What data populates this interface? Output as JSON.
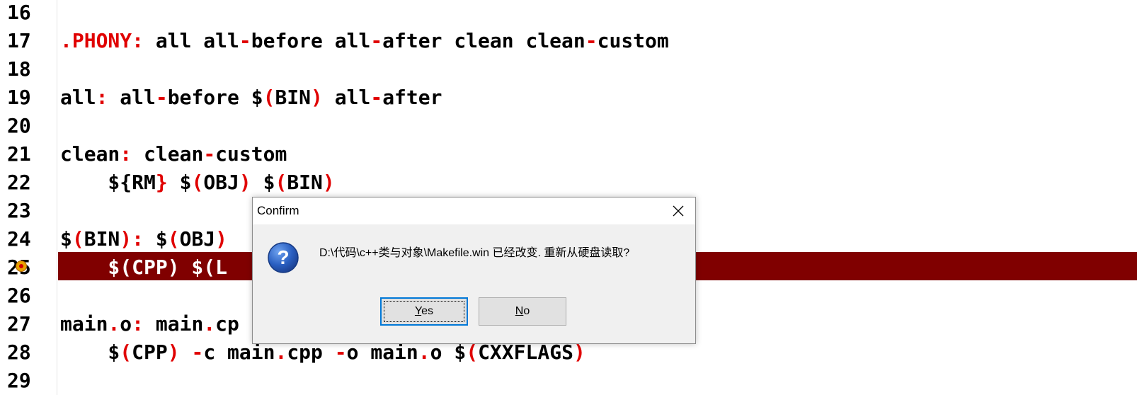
{
  "editor": {
    "lines": [
      {
        "num": "16",
        "segments": []
      },
      {
        "num": "17",
        "segments": [
          {
            "t": ".PHONY",
            "c": "red"
          },
          {
            "t": ":",
            "c": "red"
          },
          {
            "t": " all all",
            "c": ""
          },
          {
            "t": "-",
            "c": "red"
          },
          {
            "t": "before all",
            "c": ""
          },
          {
            "t": "-",
            "c": "red"
          },
          {
            "t": "after clean clean",
            "c": ""
          },
          {
            "t": "-",
            "c": "red"
          },
          {
            "t": "custom",
            "c": ""
          }
        ]
      },
      {
        "num": "18",
        "segments": []
      },
      {
        "num": "19",
        "segments": [
          {
            "t": "all",
            "c": ""
          },
          {
            "t": ":",
            "c": "red"
          },
          {
            "t": " all",
            "c": ""
          },
          {
            "t": "-",
            "c": "red"
          },
          {
            "t": "before $",
            "c": ""
          },
          {
            "t": "(",
            "c": "red"
          },
          {
            "t": "BIN",
            "c": ""
          },
          {
            "t": ")",
            "c": "red"
          },
          {
            "t": " all",
            "c": ""
          },
          {
            "t": "-",
            "c": "red"
          },
          {
            "t": "after",
            "c": ""
          }
        ]
      },
      {
        "num": "20",
        "segments": []
      },
      {
        "num": "21",
        "segments": [
          {
            "t": "clean",
            "c": ""
          },
          {
            "t": ":",
            "c": "red"
          },
          {
            "t": " clean",
            "c": ""
          },
          {
            "t": "-",
            "c": "red"
          },
          {
            "t": "custom",
            "c": ""
          }
        ]
      },
      {
        "num": "22",
        "segments": [
          {
            "t": "    ${",
            "c": ""
          },
          {
            "t": "RM",
            "c": ""
          },
          {
            "t": "}",
            "c": "red"
          },
          {
            "t": " $",
            "c": ""
          },
          {
            "t": "(",
            "c": "red"
          },
          {
            "t": "OBJ",
            "c": ""
          },
          {
            "t": ")",
            "c": "red"
          },
          {
            "t": " $",
            "c": ""
          },
          {
            "t": "(",
            "c": "red"
          },
          {
            "t": "BIN",
            "c": ""
          },
          {
            "t": ")",
            "c": "red"
          }
        ]
      },
      {
        "num": "23",
        "segments": []
      },
      {
        "num": "24",
        "segments": [
          {
            "t": "$",
            "c": ""
          },
          {
            "t": "(",
            "c": "red"
          },
          {
            "t": "BIN",
            "c": ""
          },
          {
            "t": ")",
            "c": "red"
          },
          {
            "t": ":",
            "c": "red"
          },
          {
            "t": " $",
            "c": ""
          },
          {
            "t": "(",
            "c": "red"
          },
          {
            "t": "OBJ",
            "c": ""
          },
          {
            "t": ")",
            "c": "red"
          }
        ]
      },
      {
        "num": "25",
        "active": true,
        "segments": [
          {
            "t": "    $(CPP) $(L",
            "c": ""
          }
        ]
      },
      {
        "num": "26",
        "segments": []
      },
      {
        "num": "27",
        "segments": [
          {
            "t": "main",
            "c": ""
          },
          {
            "t": ".",
            "c": "red"
          },
          {
            "t": "o",
            "c": ""
          },
          {
            "t": ":",
            "c": "red"
          },
          {
            "t": " main",
            "c": ""
          },
          {
            "t": ".",
            "c": "red"
          },
          {
            "t": "cp",
            "c": ""
          }
        ]
      },
      {
        "num": "28",
        "segments": [
          {
            "t": "    $",
            "c": ""
          },
          {
            "t": "(",
            "c": "red"
          },
          {
            "t": "CPP",
            "c": ""
          },
          {
            "t": ")",
            "c": "red"
          },
          {
            "t": " ",
            "c": ""
          },
          {
            "t": "-",
            "c": "red"
          },
          {
            "t": "c main",
            "c": ""
          },
          {
            "t": ".",
            "c": "red"
          },
          {
            "t": "cpp ",
            "c": ""
          },
          {
            "t": "-",
            "c": "red"
          },
          {
            "t": "o main",
            "c": ""
          },
          {
            "t": ".",
            "c": "red"
          },
          {
            "t": "o $",
            "c": ""
          },
          {
            "t": "(",
            "c": "red"
          },
          {
            "t": "CXXFLAGS",
            "c": ""
          },
          {
            "t": ")",
            "c": "red"
          }
        ]
      },
      {
        "num": "29",
        "segments": []
      }
    ],
    "active_line_color": "#800000",
    "syntax_accent_color": "#e00000"
  },
  "dialog": {
    "title": "Confirm",
    "icon": "question-icon",
    "message": "D:\\代码\\c++类与对象\\Makefile.win 已经改变. 重新从硬盘读取?",
    "yes_label": "Yes",
    "no_label": "No",
    "accent_color": "#0078d7"
  }
}
